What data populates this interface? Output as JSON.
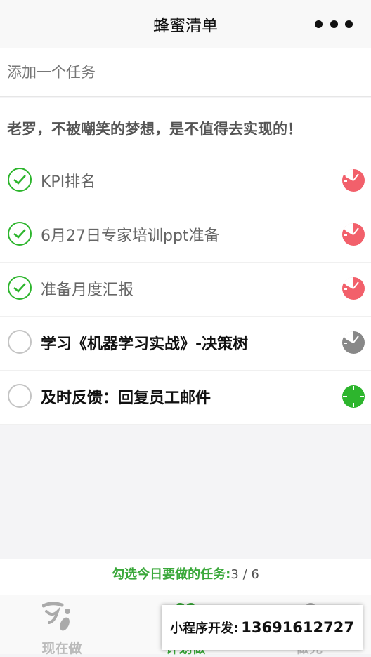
{
  "navbar": {
    "title": "蜂蜜清单",
    "more_icon": "more-dots-icon"
  },
  "add_task": {
    "placeholder": "添加一个任务",
    "value": ""
  },
  "motto": "老罗，不被嘲笑的梦想，是不值得去实现的！",
  "tasks": [
    {
      "label": "KPI排名",
      "checked": true,
      "timer_icon": "timer-icon",
      "timer_color": "#f2606b"
    },
    {
      "label": "6月27日专家培训ppt准备",
      "checked": true,
      "timer_icon": "timer-icon",
      "timer_color": "#f2606b"
    },
    {
      "label": "准备月度汇报",
      "checked": true,
      "timer_icon": "timer-icon",
      "timer_color": "#f2606b"
    },
    {
      "label": "学习《机器学习实战》-决策树",
      "checked": false,
      "timer_icon": "timer-icon",
      "timer_color": "#888888"
    },
    {
      "label": "及时反馈：回复员工邮件",
      "checked": false,
      "timer_icon": "timer-icon",
      "timer_color": "#2db52d"
    }
  ],
  "status": {
    "label": "勾选今日要做的任务:",
    "count": "3 / 6"
  },
  "tabbar": {
    "tabs": [
      {
        "label": "现在做",
        "icon": "now-icon",
        "active": false
      },
      {
        "label": "计划做",
        "icon": "plan-icon",
        "active": true
      },
      {
        "label": "做完",
        "icon": "done-icon",
        "active": false
      }
    ]
  },
  "contact": {
    "label": "小程序开发:",
    "phone": "13691612727"
  },
  "colors": {
    "accent_green": "#2db52d",
    "timer_red": "#f2606b",
    "timer_gray": "#888888"
  }
}
